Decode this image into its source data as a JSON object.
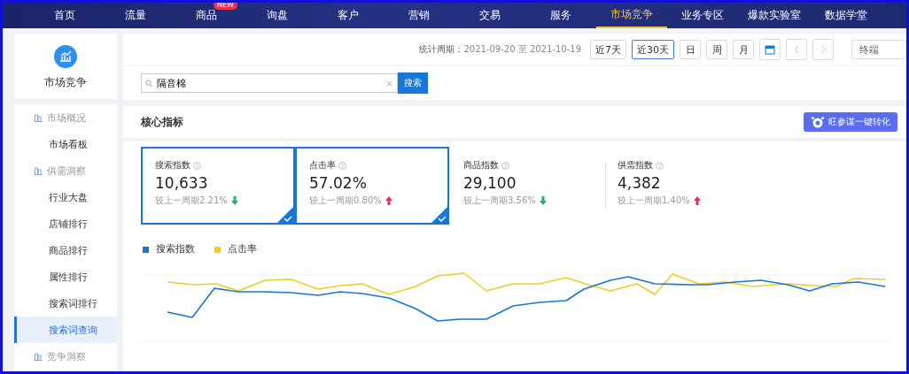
{
  "nav": {
    "items": [
      {
        "label": "首页",
        "selected": false
      },
      {
        "label": "流量",
        "selected": false
      },
      {
        "label": "商品",
        "selected": false,
        "badge": "NEW"
      },
      {
        "label": "询盘",
        "selected": false
      },
      {
        "label": "客户",
        "selected": false
      },
      {
        "label": "营销",
        "selected": false
      },
      {
        "label": "交易",
        "selected": false
      },
      {
        "label": "服务",
        "selected": false
      },
      {
        "label": "市场竞争",
        "selected": true
      },
      {
        "label": "业务专区",
        "selected": false
      },
      {
        "label": "爆款实验室",
        "selected": false
      },
      {
        "label": "数据学堂",
        "selected": false
      }
    ]
  },
  "sidebar": {
    "title": "市场竞争",
    "items": [
      {
        "kind": "group",
        "label": "市场概况",
        "selected": false
      },
      {
        "kind": "link",
        "label": "市场看板",
        "selected": false
      },
      {
        "kind": "group",
        "label": "供需洞察",
        "selected": false
      },
      {
        "kind": "link",
        "label": "行业大盘",
        "selected": false
      },
      {
        "kind": "link",
        "label": "店铺排行",
        "selected": false
      },
      {
        "kind": "link",
        "label": "商品排行",
        "selected": false
      },
      {
        "kind": "link",
        "label": "属性排行",
        "selected": false
      },
      {
        "kind": "link",
        "label": "搜索词排行",
        "selected": false
      },
      {
        "kind": "link",
        "label": "搜索词查询",
        "selected": true
      },
      {
        "kind": "group",
        "label": "竞争洞察",
        "selected": false
      }
    ]
  },
  "period": {
    "label": "统计周期：",
    "value": "2021-09-20 至 2021-10-19",
    "ranges": [
      {
        "label": "近7天",
        "selected": false
      },
      {
        "label": "近30天",
        "selected": true
      },
      {
        "label": "日",
        "selected": false
      },
      {
        "label": "周",
        "selected": false
      },
      {
        "label": "月",
        "selected": false
      }
    ],
    "terminal": "终端"
  },
  "search": {
    "value": "隔音棉",
    "button": "搜索"
  },
  "metrics": {
    "title": "核心指标",
    "action": "旺参谋一键转化",
    "cards": [
      {
        "name": "搜索指数",
        "value": "10,633",
        "compare": "较上一周期2.21%",
        "kind": "fall",
        "selected": true
      },
      {
        "name": "点击率",
        "value": "57.02%",
        "compare": "较上一周期0.80%",
        "kind": "rise",
        "selected": true
      },
      {
        "name": "商品指数",
        "value": "29,100",
        "compare": "较上一周期3.56%",
        "kind": "fall",
        "selected": false
      },
      {
        "name": "供需指数",
        "value": "4,382",
        "compare": "较上一周期1.40%",
        "kind": "rise",
        "selected": false
      }
    ],
    "legend": [
      {
        "label": "搜索指数",
        "color": "#1677d9"
      },
      {
        "label": "点击率",
        "color": "#f0cc2a"
      }
    ]
  }
}
